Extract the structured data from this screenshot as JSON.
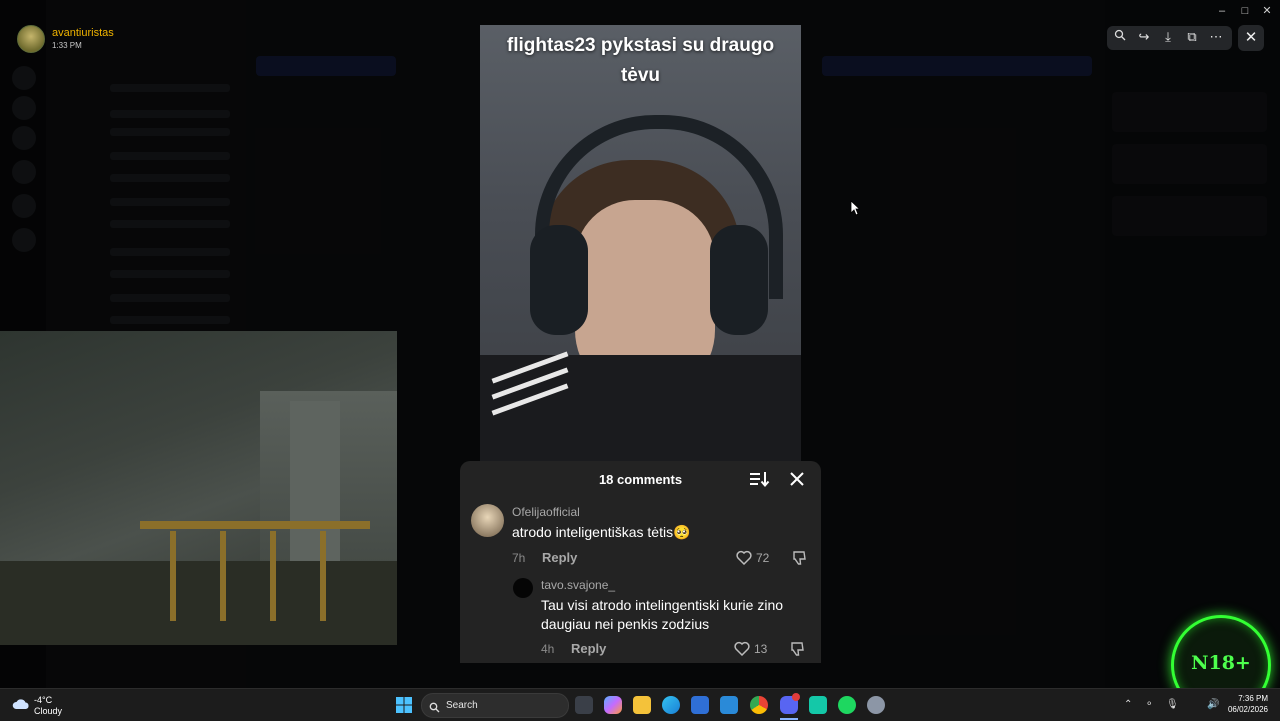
{
  "viewer": {
    "username": "avantiuristas",
    "timestamp": "1:33 PM",
    "toolbar_icons": [
      "zoom-icon",
      "forward-icon",
      "download-icon",
      "open-external-icon",
      "more-icon"
    ],
    "close_icon": "close-icon"
  },
  "video": {
    "caption_line1": "flightas23 pykstasi su draugo",
    "caption_line2": "tėvu"
  },
  "comments_panel": {
    "count_label": "18 comments",
    "comments": [
      {
        "user": "Ofelijaofficial",
        "text": "atrodo inteligentiškas tėtis🥺",
        "age": "7h",
        "reply_label": "Reply",
        "likes": "72"
      },
      {
        "user": "tavo.svajone_",
        "text": "Tau visi atrodo intelingentiski kurie zino daugiau nei penkis zodzius",
        "age": "4h",
        "reply_label": "Reply",
        "likes": "13"
      }
    ]
  },
  "badge": {
    "label": "N18+",
    "color": "#33ff33"
  },
  "taskbar": {
    "weather_temp": "-4°C",
    "weather_desc": "Cloudy",
    "search_label": "Search",
    "apps": [
      "windows-start-icon",
      "task-view-icon",
      "copilot-icon",
      "file-explorer-icon",
      "edge-icon",
      "store-icon",
      "mail-icon",
      "chrome-icon",
      "discord-icon",
      "discord-alt-icon",
      "spotify-icon",
      "settings-icon"
    ],
    "clock_time": "7:36 PM",
    "clock_date": "06/02/2026"
  }
}
